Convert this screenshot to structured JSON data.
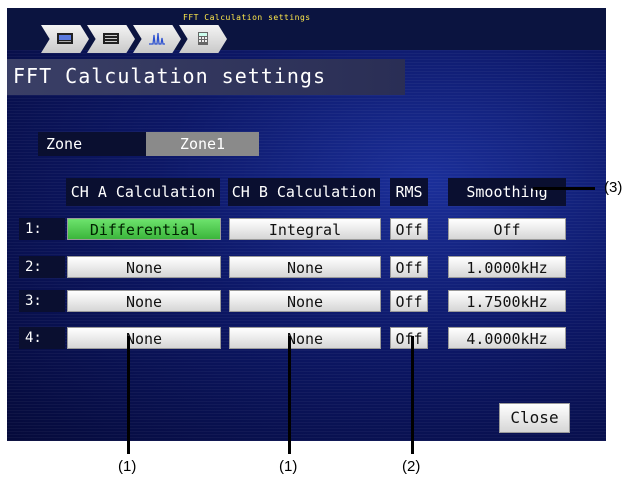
{
  "breadcrumb": {
    "title": "FFT Calculation settings",
    "items": [
      {
        "icon": "screen-icon"
      },
      {
        "icon": "display-icon"
      },
      {
        "icon": "spectrum-icon"
      },
      {
        "icon": "calculator-icon"
      }
    ]
  },
  "page_title": "FFT Calculation settings",
  "zone": {
    "label": "Zone",
    "value": "Zone1"
  },
  "table": {
    "headers": [
      "CH A Calculation",
      "CH B Calculation",
      "RMS",
      "Smoothing"
    ],
    "rows": [
      {
        "label": "1:",
        "ch_a": "Differential",
        "ch_b": "Integral",
        "rms": "Off",
        "smoothing": "Off",
        "ch_a_active": true
      },
      {
        "label": "2:",
        "ch_a": "None",
        "ch_b": "None",
        "rms": "Off",
        "smoothing": "1.0000kHz",
        "ch_a_active": false
      },
      {
        "label": "3:",
        "ch_a": "None",
        "ch_b": "None",
        "rms": "Off",
        "smoothing": "1.7500kHz",
        "ch_a_active": false
      },
      {
        "label": "4:",
        "ch_a": "None",
        "ch_b": "None",
        "rms": "Off",
        "smoothing": "4.0000kHz",
        "ch_a_active": false
      }
    ]
  },
  "close_label": "Close",
  "callouts": [
    "(1)",
    "(1)",
    "(2)",
    "(3)"
  ],
  "colors": {
    "active": "#4fcf4f",
    "background": "#0c1766",
    "title_text": "#ffe94a"
  }
}
